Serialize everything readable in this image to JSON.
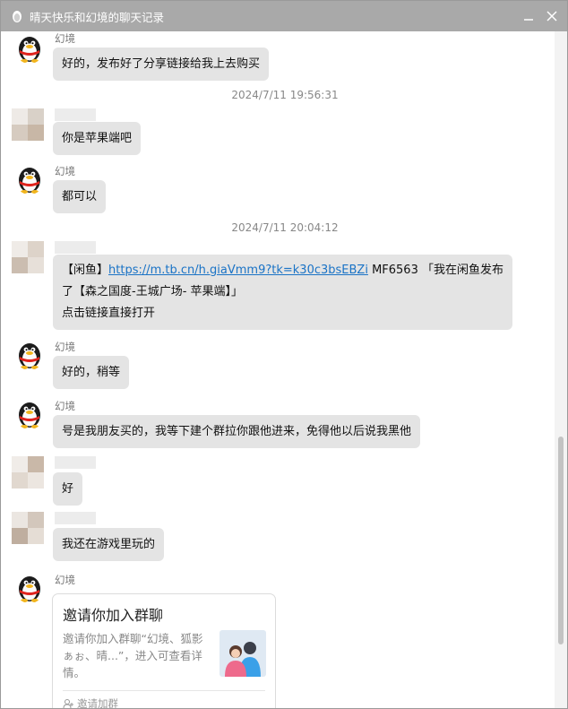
{
  "window": {
    "title": "晴天快乐和幻境的聊天记录"
  },
  "contact_name": "幻境",
  "timestamps": [
    "2024/7/11 19:56:31",
    "2024/7/11 20:04:12"
  ],
  "messages": {
    "m1": "好的，发布好了分享链接给我上去购买",
    "m2": "你是苹果端吧",
    "m3": "都可以",
    "m4": {
      "prefix": "【闲鱼】",
      "link": "https://m.tb.cn/h.giaVmm9?tk=k30c3bsEBZi",
      "suffix": " MF6563 「我在闲鱼发布了【森之国度-王城广场- 苹果端】」",
      "line3": "点击链接直接打开"
    },
    "m5": "好的，稍等",
    "m6": "号是我朋友买的，我等下建个群拉你跟他进来，免得他以后说我黑他",
    "m7": "好",
    "m8": "我还在游戏里玩的"
  },
  "invite_card": {
    "title": "邀请你加入群聊",
    "desc": "邀请你加入群聊“幻境、狐影ぁぉ、晴...”，进入可查看详情。",
    "footer": "邀请加群"
  },
  "colors": {
    "titlebar": "#a9a9a9",
    "bubble": "#e4e4e4",
    "link": "#1a73c6"
  }
}
